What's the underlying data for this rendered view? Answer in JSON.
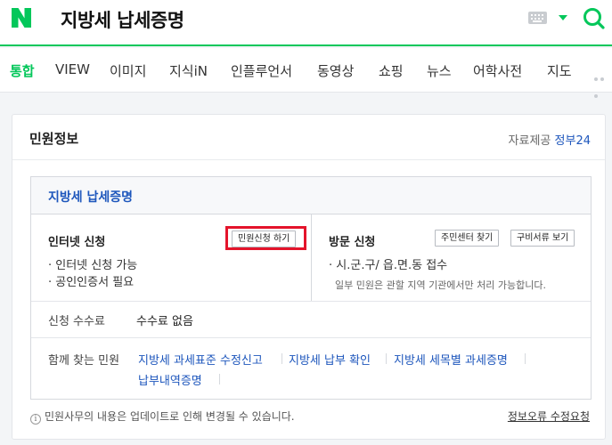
{
  "header": {
    "logo_letter": "N",
    "query": "지방세 납세증명",
    "brand_color": "#03c75a"
  },
  "tabs": [
    {
      "label": "통합",
      "active": true
    },
    {
      "label": "VIEW"
    },
    {
      "label": "이미지"
    },
    {
      "label": "지식iN"
    },
    {
      "label": "인플루언서"
    },
    {
      "label": "동영상"
    },
    {
      "label": "쇼핑"
    },
    {
      "label": "뉴스"
    },
    {
      "label": "어학사전"
    },
    {
      "label": "지도"
    }
  ],
  "card": {
    "title": "민원정보",
    "provider_prefix": "자료제공",
    "provider_org": "정부24",
    "box_title": "지방세 납세증명",
    "internet": {
      "title": "인터넷 신청",
      "apply_button": "민원신청 하기",
      "bullets": [
        "· 인터넷 신청 가능",
        "· 공인인증서 필요"
      ]
    },
    "visit": {
      "title": "방문 신청",
      "button_center": "주민센터 찾기",
      "button_docs": "구비서류 보기",
      "bullet": "· 시.군.구/ 읍.면.동 접수",
      "note": "일부 민원은 관할 지역 기관에서만 처리 가능합니다."
    },
    "fee": {
      "label": "신청 수수료",
      "value": "수수료 없음"
    },
    "related": {
      "label": "함께 찾는 민원",
      "links": [
        "지방세 과세표준 수정신고",
        "지방세 납부 확인",
        "지방세 세목별 과세증명",
        "납부내역증명"
      ]
    },
    "footer_info": "민원사무의 내용은 업데이트로 인해 변경될 수 있습니다.",
    "footer_link": "정보오류 수정요청"
  },
  "colors": {
    "accent_link": "#1d56bc",
    "highlight": "#e4142b"
  }
}
